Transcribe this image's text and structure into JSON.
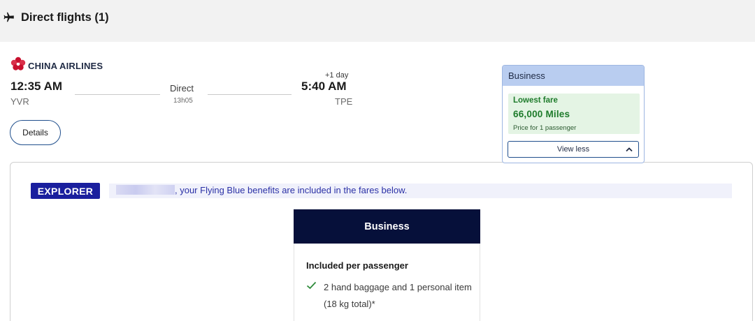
{
  "header": {
    "title": "Direct flights (1)",
    "icon": "airplane-icon"
  },
  "flight": {
    "airline": "CHINA AIRLINES",
    "airline_logo": "plum-blossom-logo",
    "departure_time": "12:35 AM",
    "departure_code": "YVR",
    "stops": "Direct",
    "duration": "13h05",
    "day_offset": "+1 day",
    "arrival_time": "5:40 AM",
    "arrival_code": "TPE",
    "details_label": "Details"
  },
  "fare": {
    "cabin": "Business",
    "badge": "Lowest fare",
    "price": "66,000 Miles",
    "note": "Price for 1 passenger",
    "toggle_label": "View less",
    "toggle_icon": "chevron-up-icon"
  },
  "benefits": {
    "tier": "EXPLORER",
    "message": ", your Flying Blue benefits are included in the fares below."
  },
  "cabin_detail": {
    "title": "Business",
    "included_heading": "Included per passenger",
    "items": [
      {
        "icon": "check-icon",
        "text": "2 hand baggage and 1 personal item (18 kg total)*"
      }
    ]
  },
  "colors": {
    "navy": "#06103a",
    "explorer_blue": "#1a1f9e",
    "fare_head": "#b9cdf0",
    "green_bg": "#e4f4e4",
    "green_text": "#1e7b2b",
    "airline_red": "#c8102e"
  }
}
